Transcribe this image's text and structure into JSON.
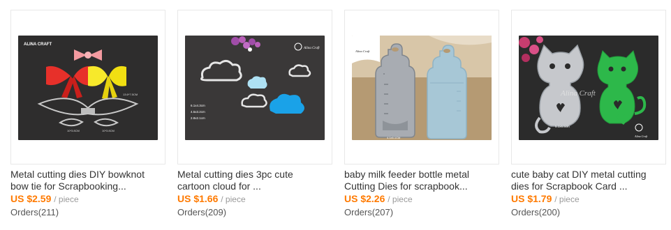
{
  "products": [
    {
      "title_line1": "Metal cutting dies DIY bowknot",
      "title_line2": "bow tie for Scrapbooking...",
      "price": "US $2.59",
      "unit": "/ piece",
      "orders": "Orders(211)",
      "image_icon": "bow-dies-image",
      "image_text": [
        "ALINA CRAFT",
        "13.6*7.5CM",
        "10*3.8CM",
        "10*3.8CM"
      ]
    },
    {
      "title_line1": "Metal cutting dies 3pc cute",
      "title_line2": "cartoon cloud for ...",
      "price": "US $1.66",
      "unit": "/ piece",
      "orders": "Orders(209)",
      "image_icon": "cloud-dies-image",
      "image_text": [
        "Alina Craft",
        "6.1x4.3cm",
        "4.5x3.2cm",
        "2.8x2.1cm"
      ]
    },
    {
      "title_line1": "baby milk feeder bottle metal",
      "title_line2": "Cutting Dies for scrapbook...",
      "price": "US $2.26",
      "unit": "/ piece",
      "orders": "Orders(207)",
      "image_icon": "bottle-dies-image",
      "image_text": [
        "Alina Craft",
        "4.1x6.1CM"
      ]
    },
    {
      "title_line1": "cute baby cat DIY metal cutting",
      "title_line2": "dies for Scrapbook Card ...",
      "price": "US $1.79",
      "unit": "/ piece",
      "orders": "Orders(200)",
      "image_icon": "cat-dies-image",
      "image_text": [
        "Alina Craft",
        "5.1x6.5cm",
        "Alina Craft"
      ]
    }
  ],
  "colors": {
    "price": "#ff7a00",
    "title": "#333333",
    "unit": "#999999",
    "orders": "#555555",
    "thumb_border": "#e8e8e8",
    "photo_background": "#2e2d2d"
  }
}
